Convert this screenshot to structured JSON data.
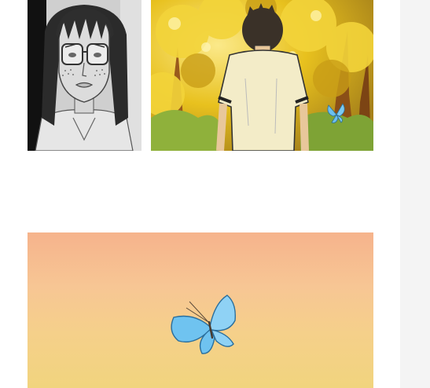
{
  "panels": [
    {
      "name": "girl-with-glasses-panel",
      "scene": "glasses-girl-close-up"
    },
    {
      "name": "boy-walking-away-panel",
      "scene": "boy-back-view-autumn-trees"
    },
    {
      "name": "butterfly-sky-panel",
      "scene": "blue-butterfly-orange-sky"
    }
  ],
  "colors": {
    "background": "#ffffff",
    "sky_top": "#f6b38c",
    "sky_bottom": "#f1d47e",
    "foliage": "#e9c21f",
    "butterfly": "#6cc0ee"
  }
}
